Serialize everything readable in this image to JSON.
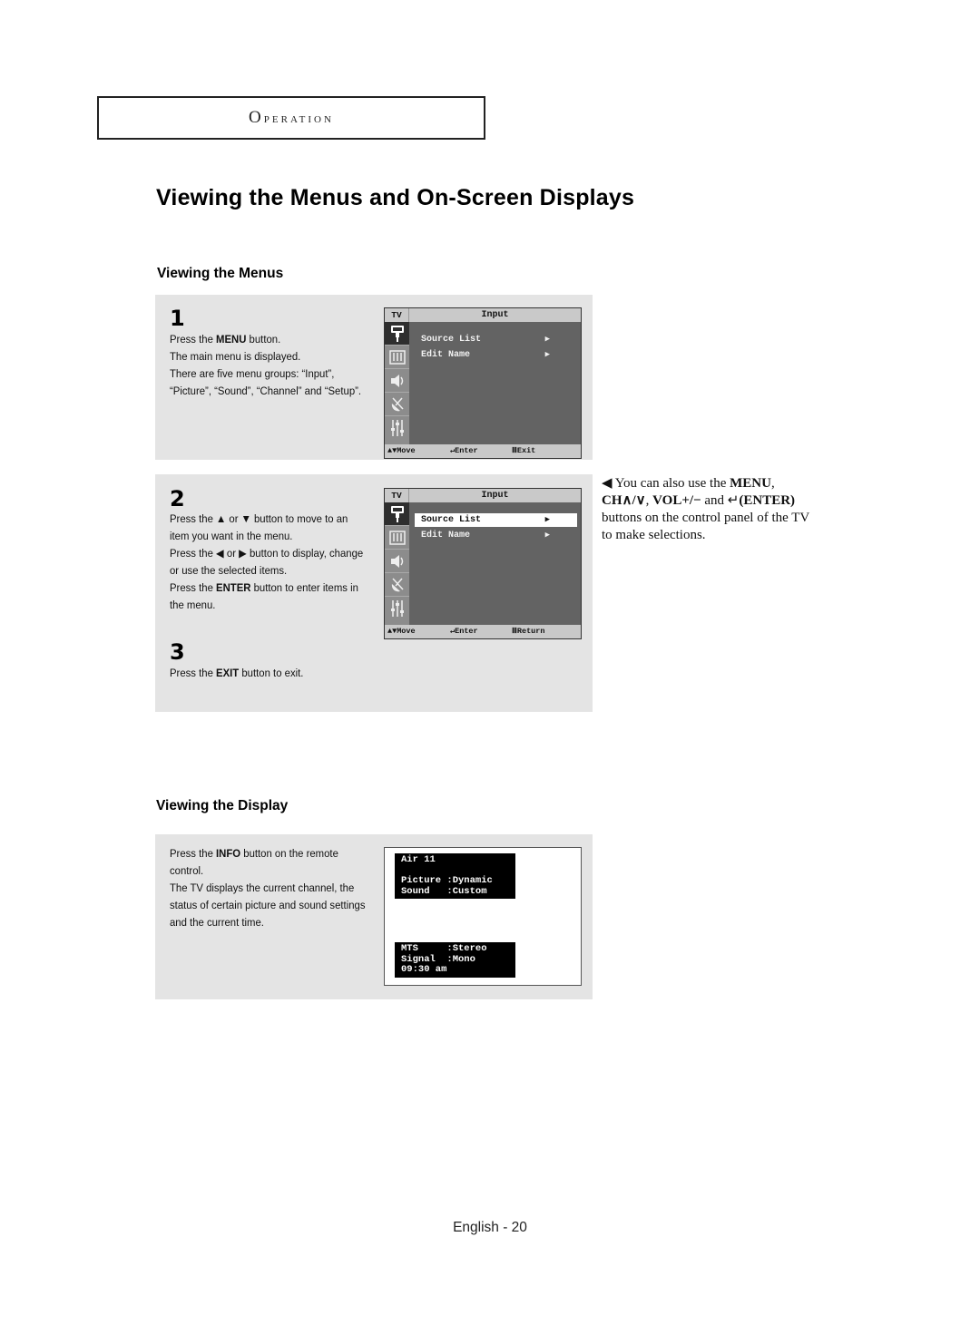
{
  "section_header": "Operation",
  "page_title": "Viewing the Menus and On-Screen Displays",
  "menus_section": {
    "title": "Viewing the Menus",
    "steps": [
      {
        "number": "1",
        "lines": [
          {
            "pre": "Press the ",
            "bold": "MENU",
            "post": " button."
          },
          {
            "pre": "The main menu is displayed.",
            "bold": "",
            "post": ""
          },
          {
            "pre": "There are five menu groups: “Input”, “Picture”, “Sound”, “Channel” and “Setup”.",
            "bold": "",
            "post": ""
          }
        ],
        "osd": {
          "tv_label": "TV",
          "title": "Input",
          "icons": [
            "input-icon",
            "picture-icon",
            "sound-icon",
            "channel-icon",
            "setup-icon"
          ],
          "items": [
            {
              "label": "Source List",
              "arrow": "▶",
              "selected": false
            },
            {
              "label": "Edit Name",
              "arrow": "▶",
              "selected": false
            }
          ],
          "footer": {
            "move": "▲▼Move",
            "enter": "Enter",
            "exit": "Exit"
          }
        }
      },
      {
        "number": "2",
        "lines": [
          {
            "pre": "Press the ▲ or ▼ button to move to an item you want in the menu.",
            "bold": "",
            "post": ""
          },
          {
            "pre": "Press the ◀ or ▶ button to display, change or use the selected items.",
            "bold": "",
            "post": ""
          },
          {
            "pre": "Press the ",
            "bold": "ENTER",
            "post": " button to enter items in the menu."
          }
        ],
        "osd": {
          "tv_label": "TV",
          "title": "Input",
          "icons": [
            "input-icon",
            "picture-icon",
            "sound-icon",
            "channel-icon",
            "setup-icon"
          ],
          "items": [
            {
              "label": "Source List",
              "arrow": "▶",
              "selected": true
            },
            {
              "label": "Edit Name",
              "arrow": "▶",
              "selected": false
            }
          ],
          "footer": {
            "move": "▲▼Move",
            "enter": "Enter",
            "exit": "Return"
          }
        }
      },
      {
        "number": "3",
        "lines": [
          {
            "pre": "Press the ",
            "bold": "EXIT",
            "post": " button to exit."
          }
        ]
      }
    ],
    "side_note": {
      "pre": "◀ You can also use the ",
      "menu": "MENU",
      "ch": "CH∧/∨",
      "vol": "VOL+/−",
      "and": " and ",
      "enter": "(ENTER)",
      "post": " buttons on the control panel of the TV to make selections."
    }
  },
  "display_section": {
    "title": "Viewing the Display",
    "lines": [
      {
        "pre": "Press the ",
        "bold": "INFO",
        "post": " button on the remote control."
      },
      {
        "pre": "The TV displays the current channel, the status of certain picture and sound settings and the current time.",
        "bold": "",
        "post": ""
      }
    ],
    "info_top": "Air 11\n\nPicture :Dynamic\nSound   :Custom",
    "info_bottom": "MTS     :Stereo\nSignal  :Mono\n09:30 am"
  },
  "footer": "English - 20"
}
